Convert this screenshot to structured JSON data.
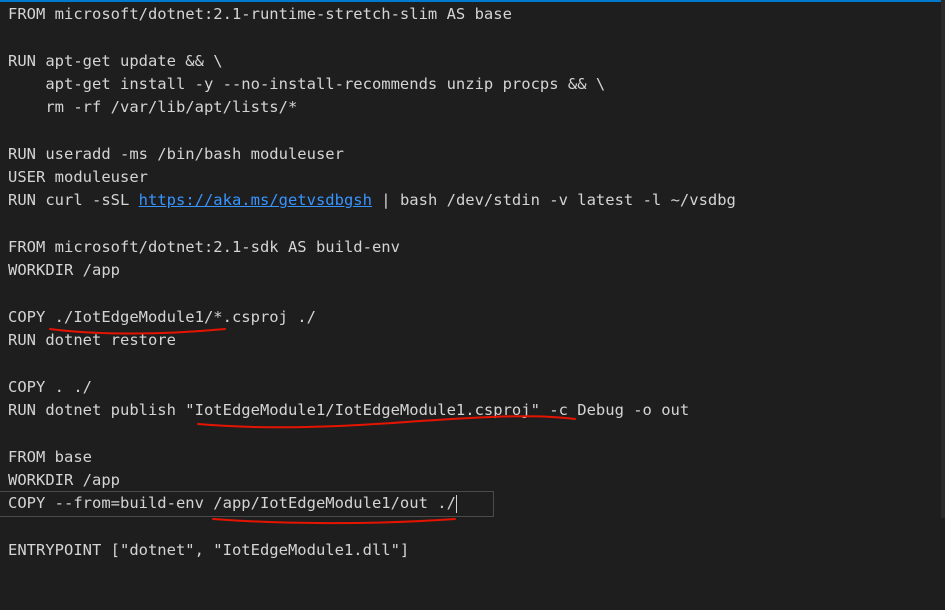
{
  "editor": {
    "lines": [
      {
        "text": "FROM microsoft/dotnet:2.1-runtime-stretch-slim AS base"
      },
      {
        "text": ""
      },
      {
        "text": "RUN apt-get update && \\"
      },
      {
        "text": "    apt-get install -y --no-install-recommends unzip procps && \\"
      },
      {
        "text": "    rm -rf /var/lib/apt/lists/*"
      },
      {
        "text": ""
      },
      {
        "text": "RUN useradd -ms /bin/bash moduleuser"
      },
      {
        "text": "USER moduleuser"
      },
      {
        "before": "RUN curl -sSL ",
        "link": "https://aka.ms/getvsdbgsh",
        "after": " | bash /dev/stdin -v latest -l ~/vsdbg"
      },
      {
        "text": ""
      },
      {
        "text": "FROM microsoft/dotnet:2.1-sdk AS build-env"
      },
      {
        "text": "WORKDIR /app"
      },
      {
        "text": ""
      },
      {
        "text": "COPY ./IotEdgeModule1/*.csproj ./"
      },
      {
        "text": "RUN dotnet restore"
      },
      {
        "text": ""
      },
      {
        "text": "COPY . ./"
      },
      {
        "text": "RUN dotnet publish \"IotEdgeModule1/IotEdgeModule1.csproj\" -c Debug -o out"
      },
      {
        "text": ""
      },
      {
        "text": "FROM base"
      },
      {
        "text": "WORKDIR /app"
      },
      {
        "text": "COPY --from=build-env /app/IotEdgeModule1/out ./"
      },
      {
        "text": ""
      },
      {
        "text": "ENTRYPOINT [\"dotnet\", \"IotEdgeModule1.dll\"]"
      }
    ]
  },
  "colors": {
    "background": "#1e1e1e",
    "text": "#d4d4d4",
    "link": "#3794ff",
    "annotation": "#e51400",
    "accent": "#007acc"
  }
}
